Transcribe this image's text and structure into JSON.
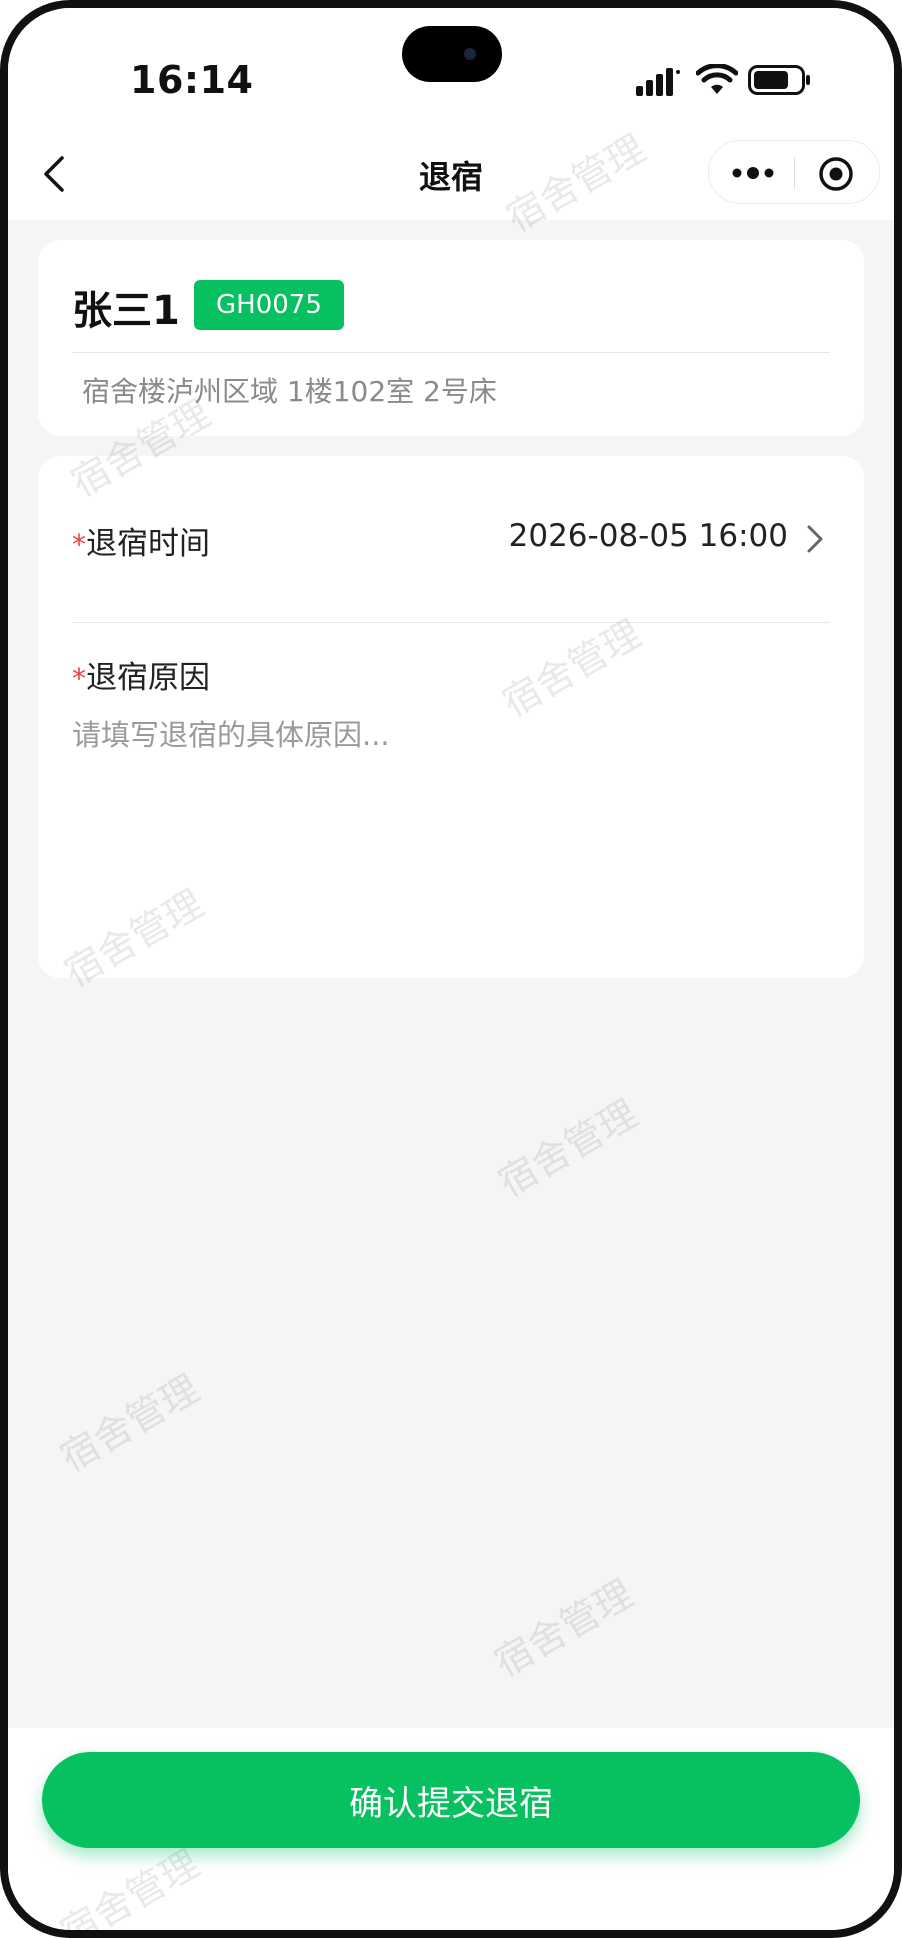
{
  "status_bar": {
    "time": "16:14"
  },
  "nav": {
    "title": "退宿"
  },
  "student": {
    "name": "张三1",
    "tag": "GH0075",
    "location": "宿舍楼泸州区域 1楼102室 2号床"
  },
  "form": {
    "required_mark": "*",
    "time_label": "退宿时间",
    "time_value": "2026-08-05 16:00",
    "reason_label": "退宿原因",
    "reason_placeholder": "请填写退宿的具体原因..."
  },
  "submit_label": "确认提交退宿",
  "watermark_text": "宿舍管理",
  "colors": {
    "accent": "#07c160",
    "required": "#e64340",
    "background": "#f5f5f5"
  }
}
